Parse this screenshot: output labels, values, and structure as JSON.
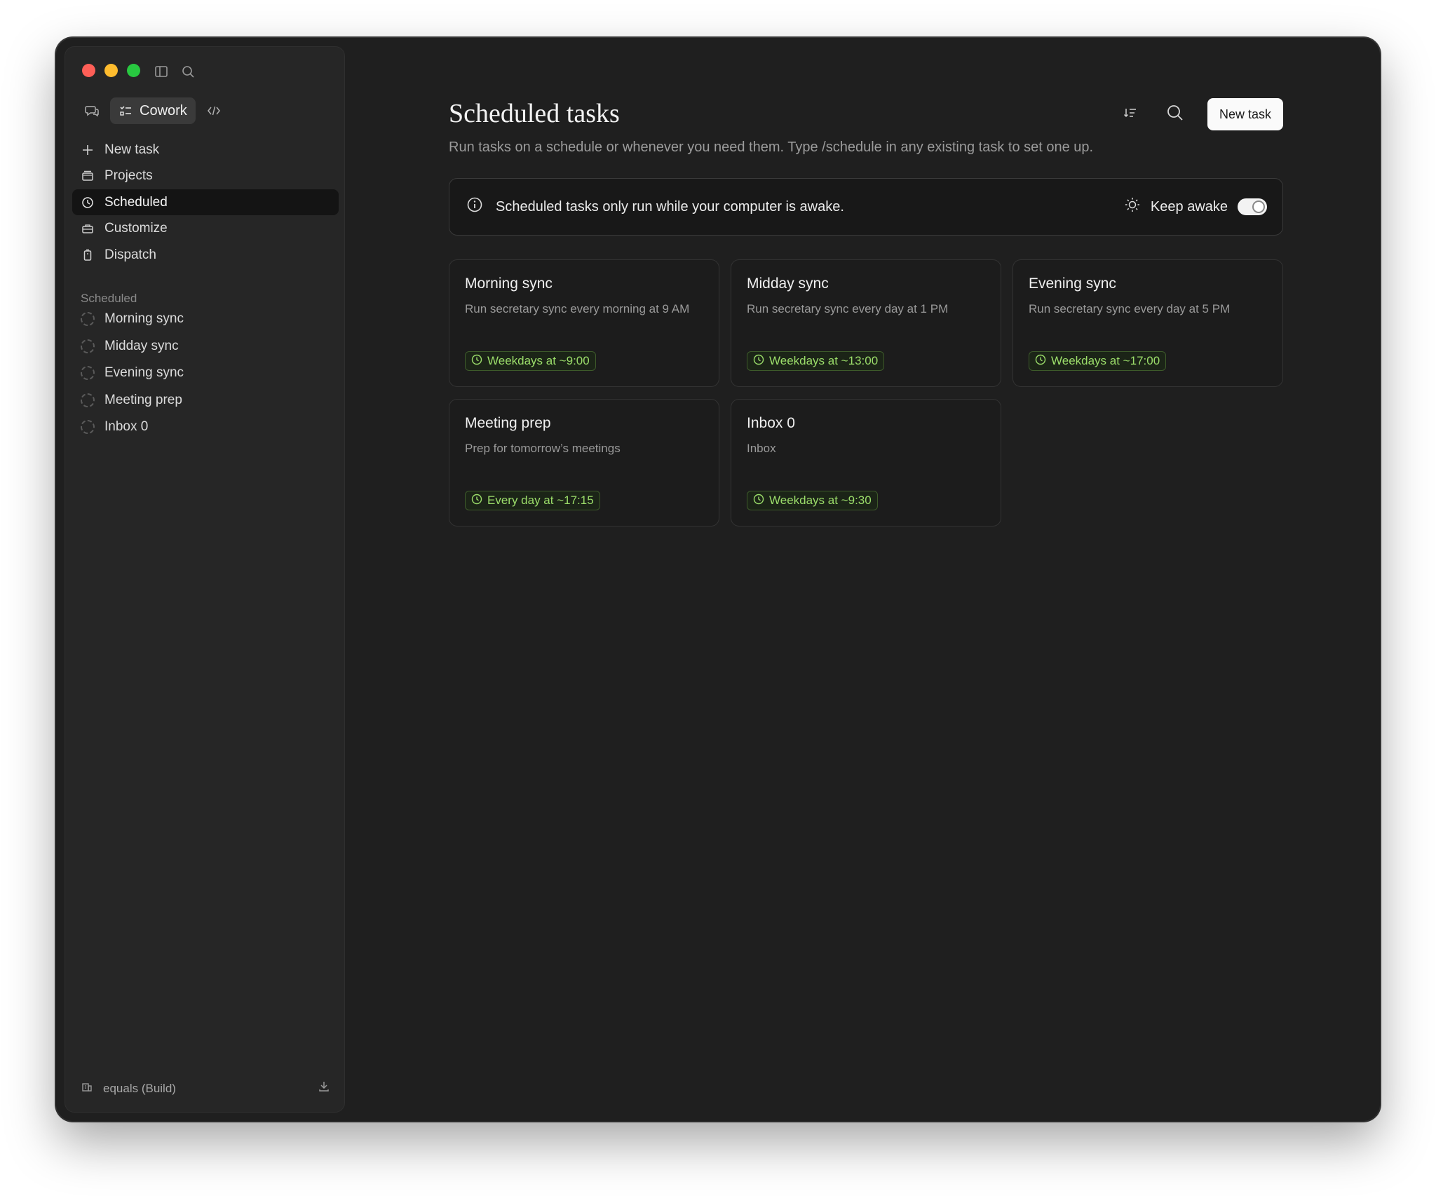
{
  "sidebar": {
    "mode_label": "Cowork",
    "nav": [
      {
        "label": "New task",
        "icon": "plus-icon"
      },
      {
        "label": "Projects",
        "icon": "folder-icon"
      },
      {
        "label": "Scheduled",
        "icon": "clock-icon",
        "active": true
      },
      {
        "label": "Customize",
        "icon": "briefcase-icon"
      },
      {
        "label": "Dispatch",
        "icon": "phone-icon"
      }
    ],
    "section_label": "Scheduled",
    "scheduled_items": [
      {
        "label": "Morning sync"
      },
      {
        "label": "Midday sync"
      },
      {
        "label": "Evening sync"
      },
      {
        "label": "Meeting prep"
      },
      {
        "label": "Inbox 0"
      }
    ],
    "footer_label": "equals (Build)"
  },
  "main": {
    "title": "Scheduled tasks",
    "subtitle": "Run tasks on a schedule or whenever you need them. Type /schedule in any existing task to set one up.",
    "new_task_label": "New task",
    "banner_text": "Scheduled tasks only run while your computer is awake.",
    "keep_awake_label": "Keep awake",
    "keep_awake_on": true
  },
  "tasks": [
    {
      "title": "Morning sync",
      "description": "Run secretary sync every morning at 9 AM",
      "schedule": "Weekdays at ~9:00"
    },
    {
      "title": "Midday sync",
      "description": "Run secretary sync every day at 1 PM",
      "schedule": "Weekdays at ~13:00"
    },
    {
      "title": "Evening sync",
      "description": "Run secretary sync every day at 5 PM",
      "schedule": "Weekdays at ~17:00"
    },
    {
      "title": "Meeting prep",
      "description": "Prep for tomorrow’s meetings",
      "schedule": "Every day at ~17:15"
    },
    {
      "title": "Inbox 0",
      "description": "Inbox",
      "schedule": "Weekdays at ~9:30"
    }
  ],
  "colors": {
    "window_bg": "#1f1f1f",
    "sidebar_bg": "#262626",
    "badge_text": "#9bdd6a",
    "badge_border": "#3d5a2a"
  }
}
